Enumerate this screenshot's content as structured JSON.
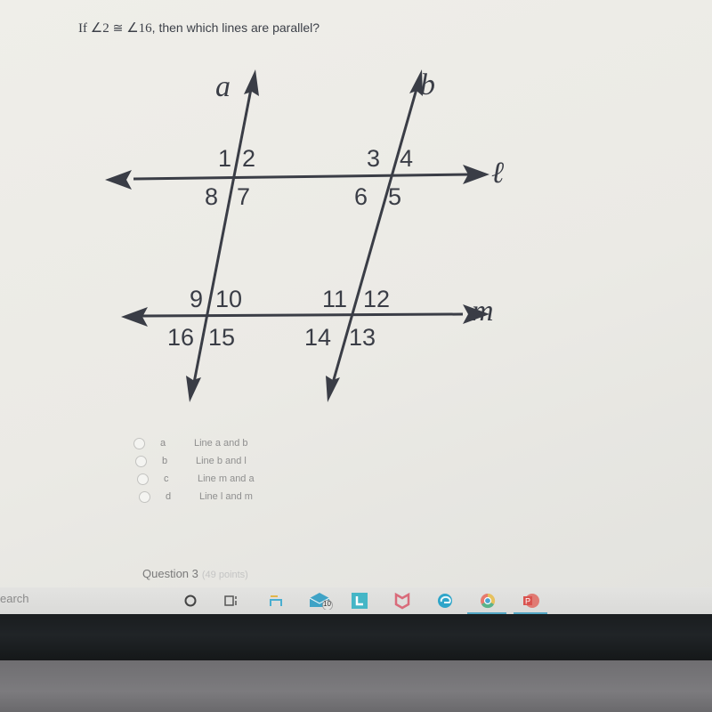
{
  "question": {
    "prefix": "If ",
    "angle_a": "∠2",
    "congruent": " ≅ ",
    "angle_b": "∠16",
    "suffix": ", then which lines are parallel?"
  },
  "diagram": {
    "line_labels": {
      "a": "a",
      "b": "b",
      "l": "ℓ",
      "m": "m"
    },
    "angles": {
      "a_l": [
        "1",
        "2",
        "8",
        "7"
      ],
      "b_l": [
        "3",
        "4",
        "6",
        "5"
      ],
      "a_m": [
        "9",
        "10",
        "16",
        "15"
      ],
      "b_m": [
        "11",
        "12",
        "14",
        "13"
      ]
    }
  },
  "options": [
    {
      "letter": "a",
      "text": "Line a and b"
    },
    {
      "letter": "b",
      "text": "Line b and l"
    },
    {
      "letter": "c",
      "text": "Line m and a"
    },
    {
      "letter": "d",
      "text": "Line l and m"
    }
  ],
  "next_question": {
    "title": "Question 3",
    "points": "(49 points)"
  },
  "taskbar": {
    "search_text": "earch",
    "mail_badge": "10",
    "icons": [
      "cortana-icon",
      "task-view-icon",
      "file-explorer-icon",
      "mail-icon",
      "l-app-icon",
      "mcafee-icon",
      "edge-icon",
      "chrome-icon",
      "powerpoint-icon"
    ],
    "colors": {
      "accent": "#52a6c4",
      "mcafee": "#d96b7a",
      "powerpoint": "#d9534f"
    }
  }
}
